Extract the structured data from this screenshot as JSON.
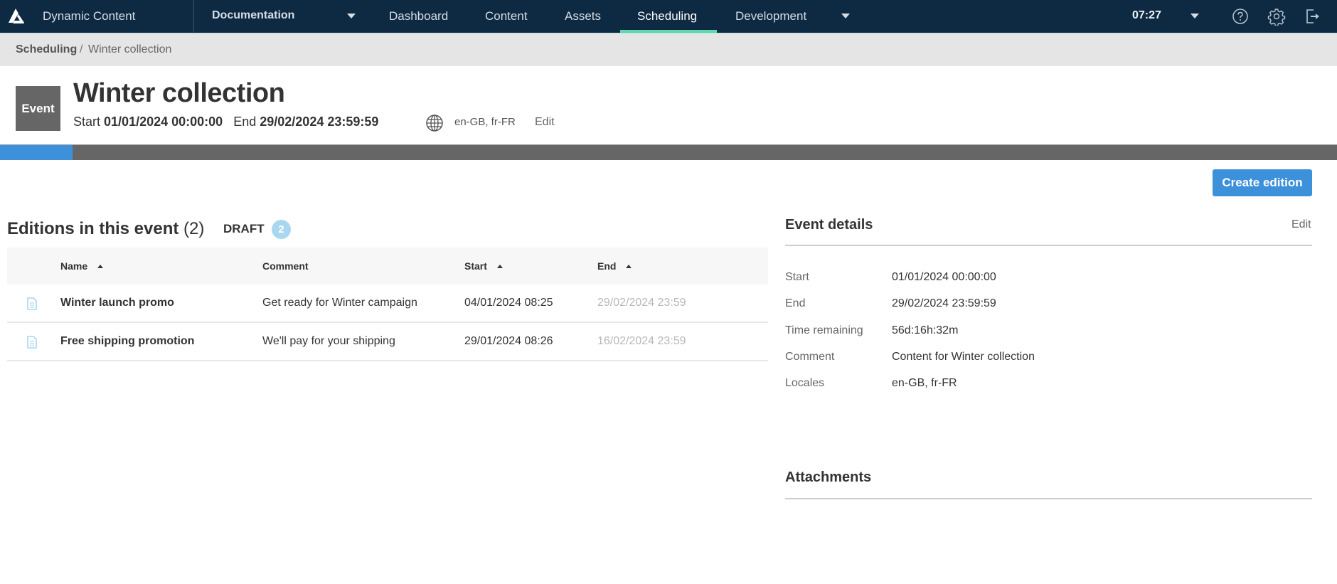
{
  "topnav": {
    "app_title": "Dynamic Content",
    "hub_name": "Documentation",
    "tabs": [
      {
        "label": "Dashboard"
      },
      {
        "label": "Content"
      },
      {
        "label": "Assets"
      },
      {
        "label": "Scheduling",
        "active": true
      },
      {
        "label": "Development"
      }
    ],
    "time": "07:27",
    "icons": [
      "help-icon",
      "settings-icon",
      "logout-icon"
    ],
    "accent_color": "#66d4b0"
  },
  "breadcrumb": {
    "root": "Scheduling",
    "separator": "/",
    "current": "Winter collection"
  },
  "header": {
    "badge": "Event",
    "title": "Winter collection",
    "start_label": "Start",
    "start_value": "01/01/2024 00:00:00",
    "end_label": "End",
    "end_value": "29/02/2024 23:59:59",
    "locales": "en-GB, fr-FR",
    "edit_label": "Edit"
  },
  "progress": {
    "percent": 5.4,
    "fill_color": "#3d91da"
  },
  "actions": {
    "create_edition": "Create edition"
  },
  "editions": {
    "title": "Editions in this event",
    "count": "(2)",
    "status_label": "DRAFT",
    "status_count": "2",
    "columns": [
      "Name",
      "Comment",
      "Start",
      "End"
    ],
    "rows": [
      {
        "name": "Winter launch promo",
        "comment": "Get ready for Winter campaign",
        "start": "04/01/2024 08:25",
        "end": "29/02/2024 23:59"
      },
      {
        "name": "Free shipping promotion",
        "comment": "We'll pay for your shipping",
        "start": "29/01/2024 08:26",
        "end": "16/02/2024 23:59"
      }
    ]
  },
  "details": {
    "title": "Event details",
    "edit_label": "Edit",
    "fields": [
      {
        "label": "Start",
        "value": "01/01/2024 00:00:00"
      },
      {
        "label": "End",
        "value": "29/02/2024 23:59:59"
      },
      {
        "label": "Time remaining",
        "value": "56d:16h:32m"
      },
      {
        "label": "Comment",
        "value": "Content for Winter collection"
      },
      {
        "label": "Locales",
        "value": "en-GB, fr-FR"
      }
    ],
    "attachments_title": "Attachments"
  }
}
